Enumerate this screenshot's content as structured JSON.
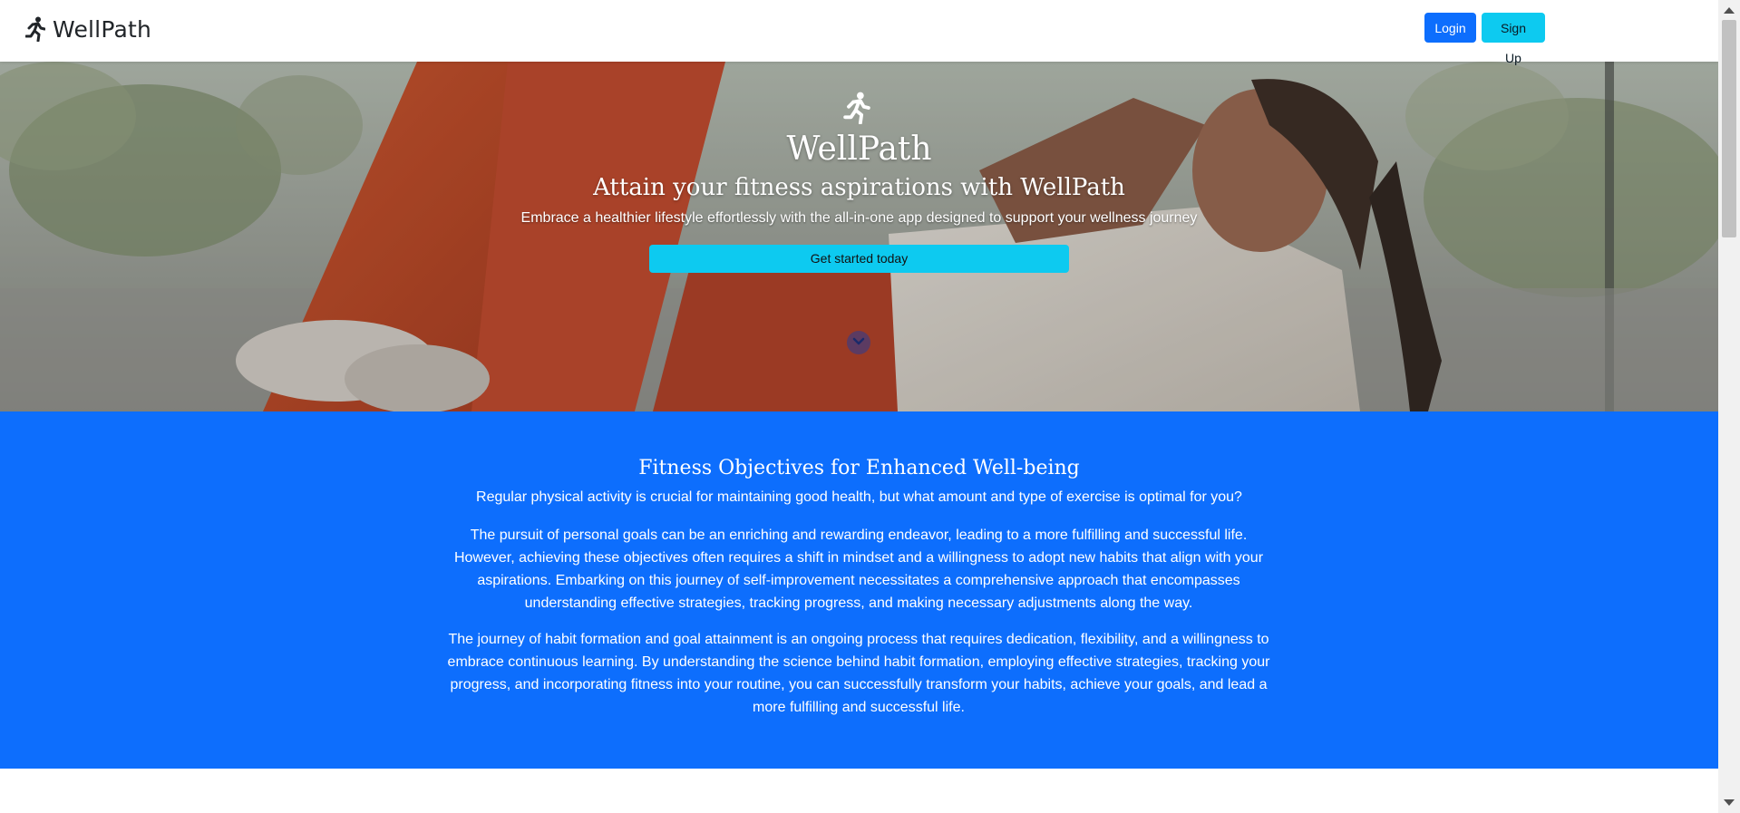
{
  "brand": {
    "name": "WellPath",
    "icon": "running-person-icon"
  },
  "nav": {
    "login_label": "Login",
    "signup_label": "Sign Up"
  },
  "hero": {
    "icon": "running-person-icon",
    "title": "WellPath",
    "subtitle": "Attain your fitness aspirations with WellPath",
    "lead": "Embrace a healthier lifestyle effortlessly with the all-in-one app designed to support your wellness journey",
    "cta_label": "Get started today",
    "scroll_icon": "chevron-down-icon"
  },
  "objectives": {
    "title": "Fitness Objectives for Enhanced Well-being",
    "lead": "Regular physical activity is crucial for maintaining good health, but what amount and type of exercise is optimal for you?",
    "paragraphs": [
      "The pursuit of personal goals can be an enriching and rewarding endeavor, leading to a more fulfilling and successful life. However, achieving these objectives often requires a shift in mindset and a willingness to adopt new habits that align with your aspirations. Embarking on this journey of self-improvement necessitates a comprehensive approach that encompasses understanding effective strategies, tracking progress, and making necessary adjustments along the way.",
      "The journey of habit formation and goal attainment is an ongoing process that requires dedication, flexibility, and a willingness to embrace continuous learning. By understanding the science behind habit formation, employing effective strategies, tracking your progress, and incorporating fitness into your routine, you can successfully transform your habits, achieve your goals, and lead a more fulfilling and successful life."
    ]
  },
  "colors": {
    "primary": "#0d6efd",
    "info": "#0dcaf0",
    "text_dark": "#212529"
  }
}
